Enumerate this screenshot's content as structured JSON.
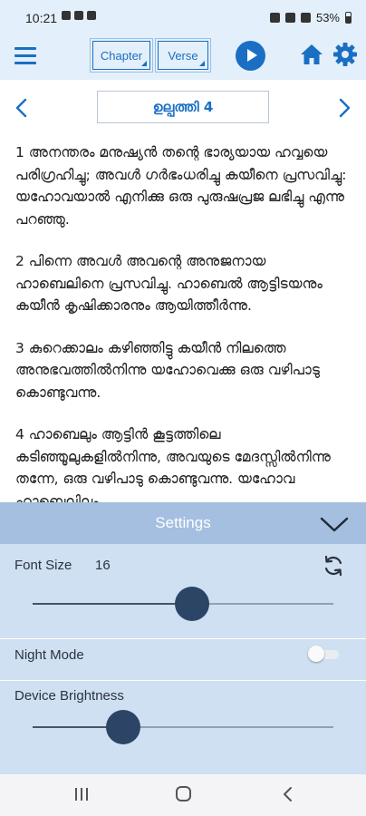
{
  "status_bar": {
    "time": "10:21",
    "battery": "53%"
  },
  "toolbar": {
    "chapter_label": "Chapter",
    "verse_label": "Verse",
    "icons": [
      "menu-icon",
      "play-icon",
      "home-icon",
      "gear-icon"
    ],
    "accent_color": "#1a6fc4"
  },
  "nav": {
    "chapter_title": "ഉല്പത്തി 4"
  },
  "verses": [
    "1 അനന്തരം മനുഷ്യൻ തന്റെ ഭാര്യയായ ഹവ്വയെ പരിഗ്രഹിച്ചു; അവൾ ഗർഭംധരിച്ചു കയീനെ പ്രസവിച്ചു: യഹോവയാൽ എനിക്കു ഒരു പുരുഷപ്രജ ലഭിച്ചു എന്നു പറഞ്ഞു.",
    "2 പിന്നെ അവൾ അവന്റെ അനുജനായ ഹാബെലിനെ പ്രസവിച്ചു. ഹാബെൽ ആട്ടിടയനും കയീൻ കൃഷിക്കാരനും ആയിത്തീർന്നു.",
    "3 കുറെക്കാലം കഴിഞ്ഞിട്ടു കയീൻ നിലത്തെ അനുഭവത്തിൽനിന്നു യഹോവെക്കു ഒരു വഴിപാടു കൊണ്ടുവന്നു.",
    "4 ഹാബെലും ആട്ടിൻ കൂട്ടത്തിലെ കടിഞ്ഞൂലുകളിൽനിന്നു, അവയുടെ മേദസ്സിൽനിന്നു തന്നേ, ഒരു വഴിപാടു കൊണ്ടുവന്നു. യഹോവ ഹാബെലിലും"
  ],
  "settings": {
    "title": "Settings",
    "font_size_label": "Font Size",
    "font_size_value": "16",
    "font_size_slider_fraction": 0.53,
    "night_mode_label": "Night Mode",
    "night_mode_on": false,
    "brightness_label": "Device Brightness",
    "brightness_slider_fraction": 0.3,
    "panel_color": "#cfe0f2",
    "header_color": "#a4bfdf"
  },
  "system_nav": {
    "icons": [
      "recent-apps-icon",
      "home-circle-icon",
      "back-icon"
    ]
  }
}
